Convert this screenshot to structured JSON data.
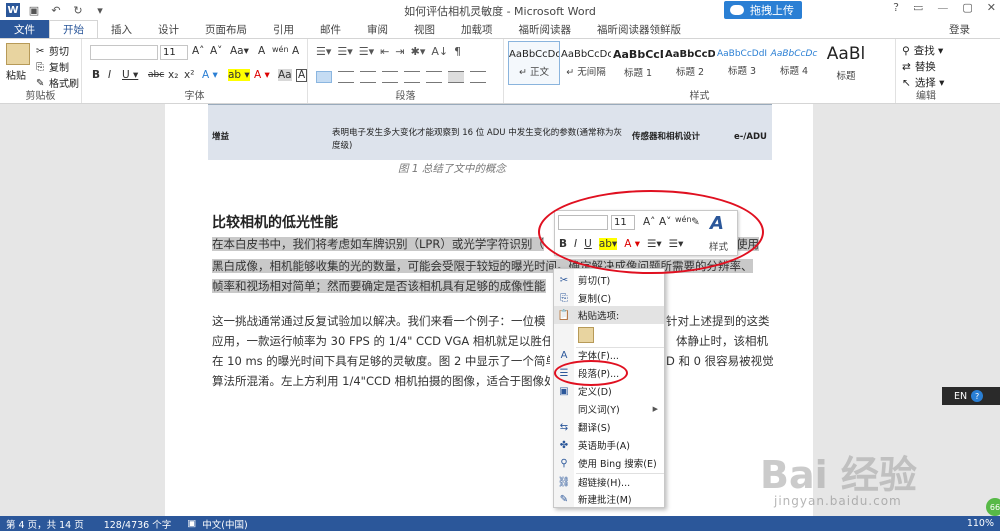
{
  "window": {
    "title": "如何评估相机灵敏度 - Microsoft Word",
    "upload_button": "拖拽上传",
    "login": "登录",
    "controls": [
      "?",
      "▭",
      "—",
      "▢",
      "✕"
    ]
  },
  "tabs": [
    "文件",
    "开始",
    "插入",
    "设计",
    "页面布局",
    "引用",
    "邮件",
    "审阅",
    "视图",
    "加载项",
    "福昕阅读器",
    "福昕阅读器领鲜版"
  ],
  "ribbon": {
    "clipboard": {
      "paste": "粘贴",
      "cut": "剪切",
      "copy": "复制",
      "format_painter": "格式刷",
      "label": "剪贴板"
    },
    "font": {
      "size": "11",
      "label": "字体",
      "row1": [
        "A˄",
        "A˅",
        "Aa▾",
        "A",
        "wén",
        "A"
      ],
      "row2": [
        "B",
        "I",
        "U ▾",
        "abc",
        "x₂",
        "x²",
        "A ▾",
        "ab ▾",
        "A ▾",
        "Aa",
        "A"
      ]
    },
    "paragraph": {
      "label": "段落",
      "row1": [
        "☰▾",
        "☰▾",
        "☰▾",
        "⇤",
        "⇥",
        "✱▾",
        "A↓",
        "¶"
      ]
    },
    "styles": {
      "label": "样式",
      "items": [
        {
          "sample": "AaBbCcDc",
          "name": "↵ 正文"
        },
        {
          "sample": "AaBbCcDc",
          "name": "↵ 无间隔"
        },
        {
          "sample": "AaBbCcD",
          "name": "标题 1"
        },
        {
          "sample": "AaBbCcD",
          "name": "标题 2"
        },
        {
          "sample": "AaBbCcDdI",
          "name": "标题 3"
        },
        {
          "sample": "AaBbCcDc",
          "name": "标题 4"
        },
        {
          "sample": "AaBl",
          "name": "标题"
        }
      ]
    },
    "editing": {
      "find": "查找 ▾",
      "replace": "替换",
      "select": "选择 ▾",
      "label": "编辑"
    }
  },
  "document": {
    "table_row": {
      "col1": "增益",
      "col2": "表明电子发生多大变化才能观察到 16 位 ADU 中发生变化的参数(通常称为灰度级)",
      "col3": "传感器和相机设计",
      "col4": "e-/ADU"
    },
    "caption": "图 1 总结了文中的概念",
    "heading": "比较相机的低光性能",
    "para1_lines": [
      "在本白皮书中，我们将考虑如车牌识别（LPR）或光学字符识别（",
      "黑白成像，相机能够收集的光的数量，可能会受限于较短的曝光时间。确定解决成像问题所需要的分辨率、",
      "帧率和视场相对简单；然而要确定是否该相机具有足够的成像性能"
    ],
    "para1_tail": "使用",
    "para2_lines": [
      "这一挑战通常通过反复试验加以解决。我们来看一个例子：一位模",
      "应用，一款运行帧率为 30 FPS 的 1/4\" CCD VGA 相机就足以胜任了。",
      "在 10 ms 的曝光时间下具有足够的灵敏度。图 2 中显示了一个简单",
      "算法所混淆。左上方利用 1/4\"CCD 相机拍摄的图像，适合于图像处"
    ],
    "para2_tails": [
      "针对上述提到的这类",
      "体静止时，该相机",
      "D 和 0 很容易被视觉",
      ""
    ]
  },
  "mini_toolbar": {
    "size": "11",
    "row1": [
      "A˄",
      "A˅",
      "wén",
      "✎"
    ],
    "row2": [
      "B",
      "I",
      "U",
      "ab▾",
      "A ▾",
      "☰▾",
      "☰▾"
    ],
    "styles_label": "样式",
    "styles_glyph": "A"
  },
  "context_menu": {
    "items": [
      {
        "icon": "✂",
        "label": "剪切(T)"
      },
      {
        "icon": "⎘",
        "label": "复制(C)"
      },
      {
        "icon": "📋",
        "label": "粘贴选项:"
      },
      {
        "icon": "A",
        "label": "字体(F)..."
      },
      {
        "icon": "☰",
        "label": "段落(P)..."
      },
      {
        "icon": "▣",
        "label": "定义(D)"
      },
      {
        "icon": "",
        "label": "同义词(Y)"
      },
      {
        "icon": "⇆",
        "label": "翻译(S)"
      },
      {
        "icon": "✤",
        "label": "英语助手(A)"
      },
      {
        "icon": "⚲",
        "label": "使用 Bing 搜索(E)"
      },
      {
        "icon": "⛓",
        "label": "超链接(H)..."
      },
      {
        "icon": "✎",
        "label": "新建批注(M)"
      }
    ]
  },
  "language_bar": {
    "lang": "EN",
    "help": "?"
  },
  "status": {
    "page": "第 4 页，共 14 页",
    "words": "128/4736 个字",
    "lang": "中文(中国)",
    "zoom": "110%"
  },
  "watermark": {
    "main": "Bai 经验",
    "sub": "jingyan.baidu.com",
    "badge": "66"
  }
}
